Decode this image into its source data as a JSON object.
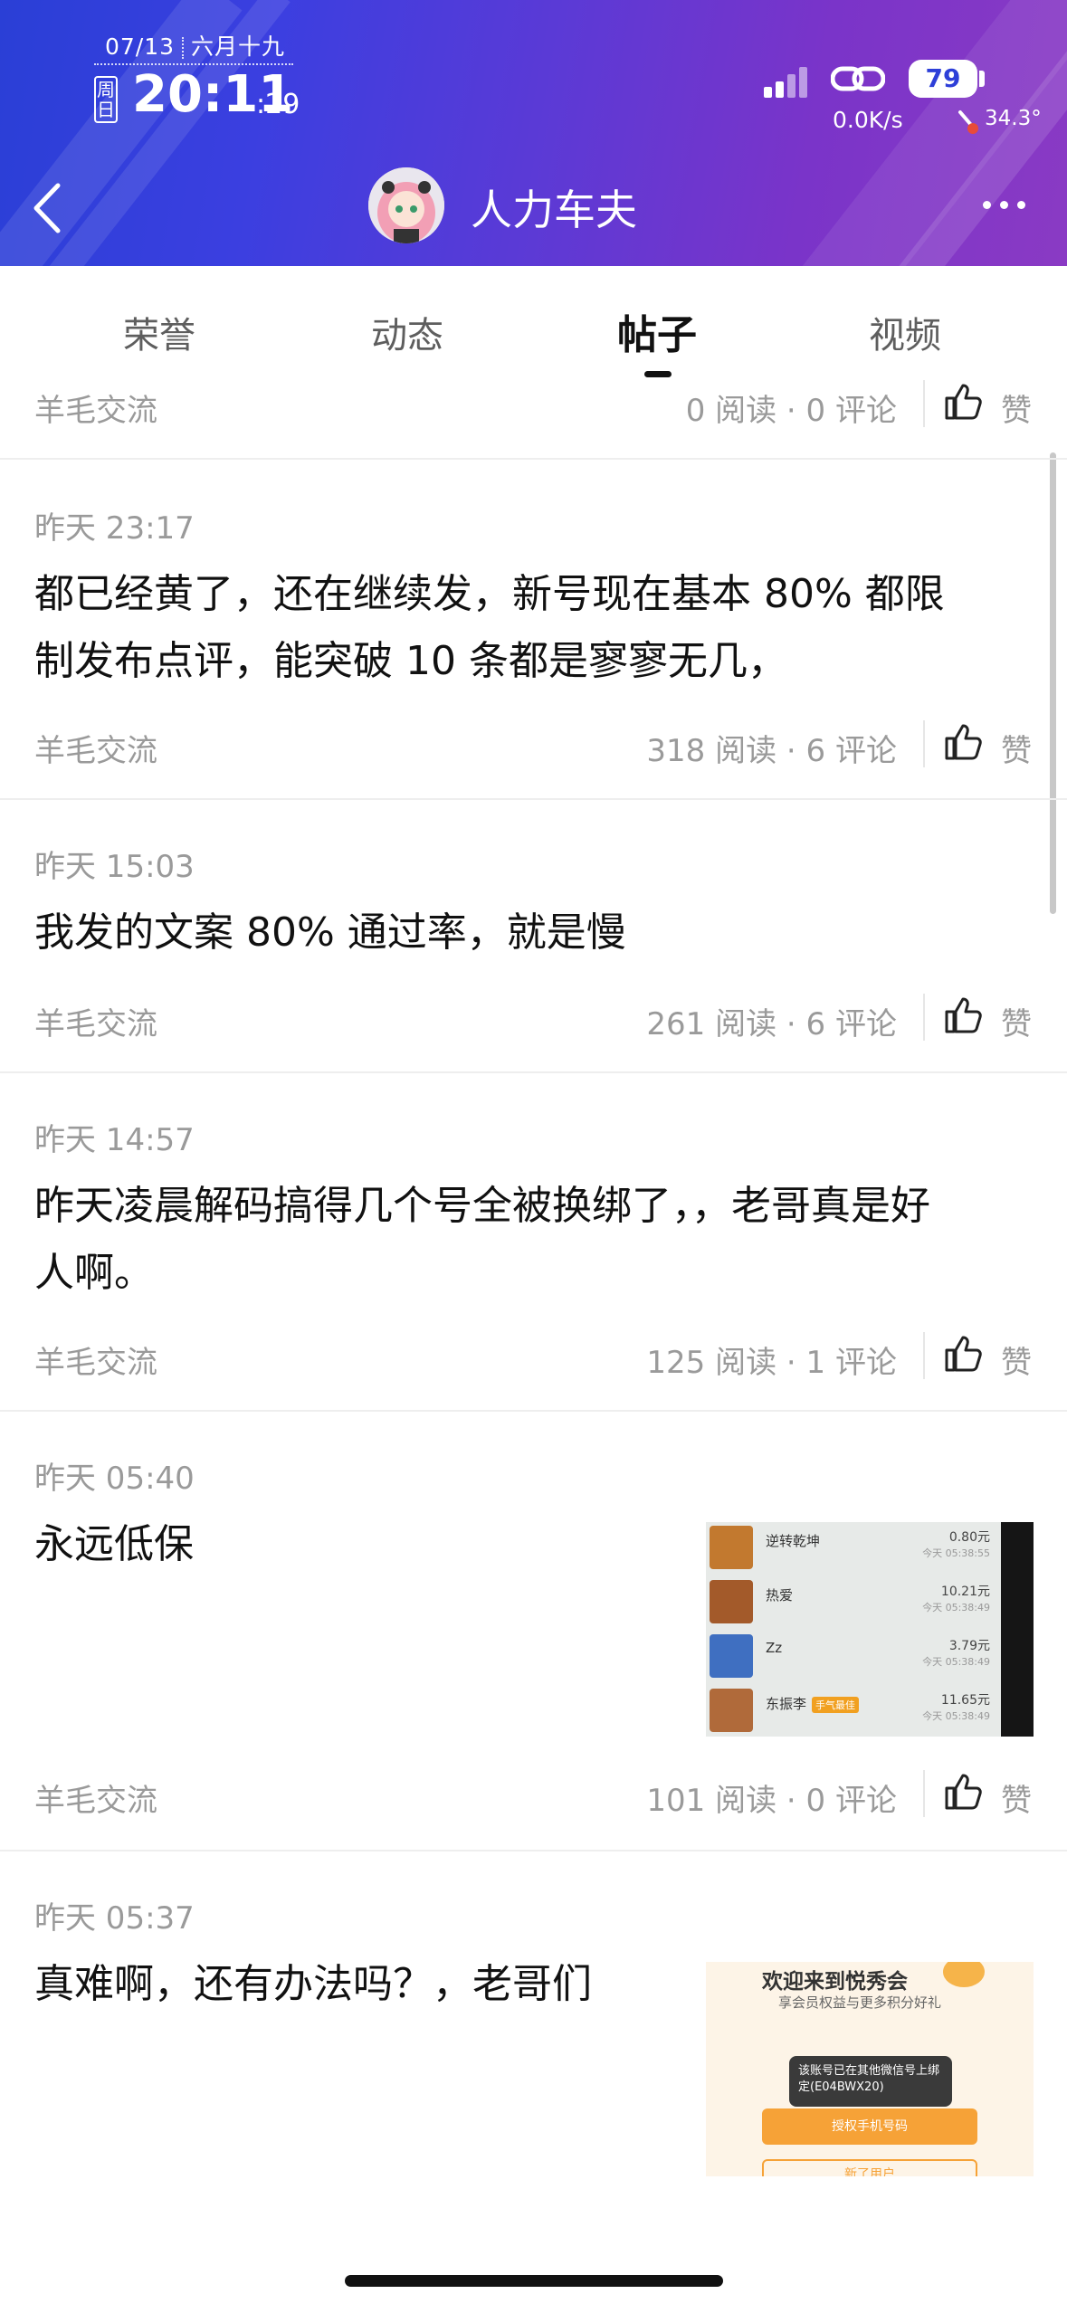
{
  "status_bar": {
    "date": "07/13",
    "lunar": "六月十九",
    "weekday": "周日",
    "time": "20:11",
    "seconds": ":29",
    "battery": "79",
    "net_speed": "0.0K/s",
    "temperature": "34.3°",
    "icons": [
      "signal-icon",
      "link-icon",
      "battery-icon",
      "thermometer-icon"
    ]
  },
  "header": {
    "nickname": "人力车夫",
    "icons": [
      "back-icon",
      "more-icon"
    ]
  },
  "tabs": [
    {
      "label": "荣誉",
      "active": false
    },
    {
      "label": "动态",
      "active": false
    },
    {
      "label": "帖子",
      "active": true
    },
    {
      "label": "视频",
      "active": false
    }
  ],
  "like_label": "赞",
  "posts": [
    {
      "time": "",
      "text": "",
      "category": "羊毛交流",
      "stats": "0 阅读 · 0 评论"
    },
    {
      "time": "昨天 23:17",
      "text_lines": [
        "都已经黄了，还在继续发，新号现在基本 80% 都限",
        "制发布点评，能突破 10 条都是寥寥无几，"
      ],
      "category": "羊毛交流",
      "stats": "318 阅读 · 6 评论"
    },
    {
      "time": "昨天 15:03",
      "text_lines": [
        "我发的文案 80% 通过率，就是慢"
      ],
      "category": "羊毛交流",
      "stats": "261 阅读 · 6 评论"
    },
    {
      "time": "昨天 14:57",
      "text_lines": [
        "昨天凌晨解码搞得几个号全被换绑了，，老哥真是好",
        "人啊。"
      ],
      "category": "羊毛交流",
      "stats": "125 阅读 · 1 评论"
    },
    {
      "time": "昨天 05:40",
      "text_lines": [
        "永远低保"
      ],
      "category": "羊毛交流",
      "stats": "101 阅读 · 0 评论",
      "thumbnail": {
        "items": [
          {
            "name": "逆转乾坤",
            "amount": "0.80元",
            "time": "今天 05:38:55",
            "color": "#c2792f"
          },
          {
            "name": "热爱",
            "amount": "10.21元",
            "time": "今天 05:38:49",
            "color": "#a35a2a"
          },
          {
            "name": "Zz",
            "amount": "3.79元",
            "time": "今天 05:38:49",
            "color": "#3f6fc1"
          },
          {
            "name": "东振李",
            "amount": "11.65元",
            "time": "今天 05:38:49",
            "color": "#b06a3a",
            "tag": "手气最佳"
          }
        ]
      }
    },
    {
      "time": "昨天 05:37",
      "text_lines": [
        "真难啊，还有办法吗？，老哥们"
      ],
      "thumbnail": {
        "title": "欢迎来到悦秀会",
        "subtitle": "享会员权益与更多积分好礼",
        "toast": "该账号已在其他微信号上绑定(E04BWX20)",
        "button": "授权手机号码",
        "button2": "新了用户"
      }
    }
  ]
}
